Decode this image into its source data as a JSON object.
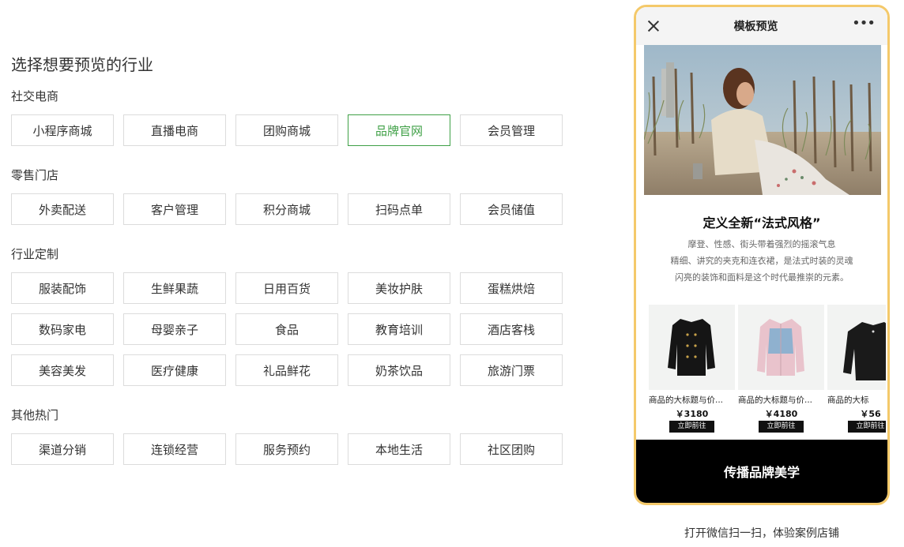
{
  "page_title": "选择想要预览的行业",
  "sections": [
    {
      "title": "社交电商",
      "options": [
        "小程序商城",
        "直播电商",
        "团购商城",
        "品牌官网",
        "会员管理"
      ]
    },
    {
      "title": "零售门店",
      "options": [
        "外卖配送",
        "客户管理",
        "积分商城",
        "扫码点单",
        "会员储值"
      ]
    },
    {
      "title": "行业定制",
      "options": [
        "服装配饰",
        "生鲜果蔬",
        "日用百货",
        "美妆护肤",
        "蛋糕烘焙",
        "数码家电",
        "母婴亲子",
        "食品",
        "教育培训",
        "酒店客栈",
        "美容美发",
        "医疗健康",
        "礼品鲜花",
        "奶茶饮品",
        "旅游门票"
      ]
    },
    {
      "title": "其他热门",
      "options": [
        "渠道分销",
        "连锁经营",
        "服务预约",
        "本地生活",
        "社区团购"
      ]
    }
  ],
  "selected_option": "品牌官网",
  "accent_color": "#3fa046",
  "phone": {
    "title": "模板预览",
    "close_icon": "close-icon",
    "more_icon": "more-icon",
    "more_glyph": "•••",
    "brand_title": "定义全新“法式风格”",
    "brand_desc": [
      "摩登、性感、街头带着强烈的摇滚气息",
      "精细、讲究的夹克和连衣裙，是法式时装的灵魂",
      "闪亮的装饰和面料是这个时代最推崇的元素。"
    ],
    "products": [
      {
        "name": "商品的大标题与价...",
        "price": "￥3180",
        "button": "立即前往"
      },
      {
        "name": "商品的大标题与价...",
        "price": "￥4180",
        "button": "立即前往"
      },
      {
        "name": "商品的大标",
        "price": "￥56",
        "button": "立即前往"
      }
    ],
    "footer_banner": "传播品牌美学",
    "frame_color": "#f4c96a"
  },
  "scan_caption": "打开微信扫一扫，体验案例店铺"
}
